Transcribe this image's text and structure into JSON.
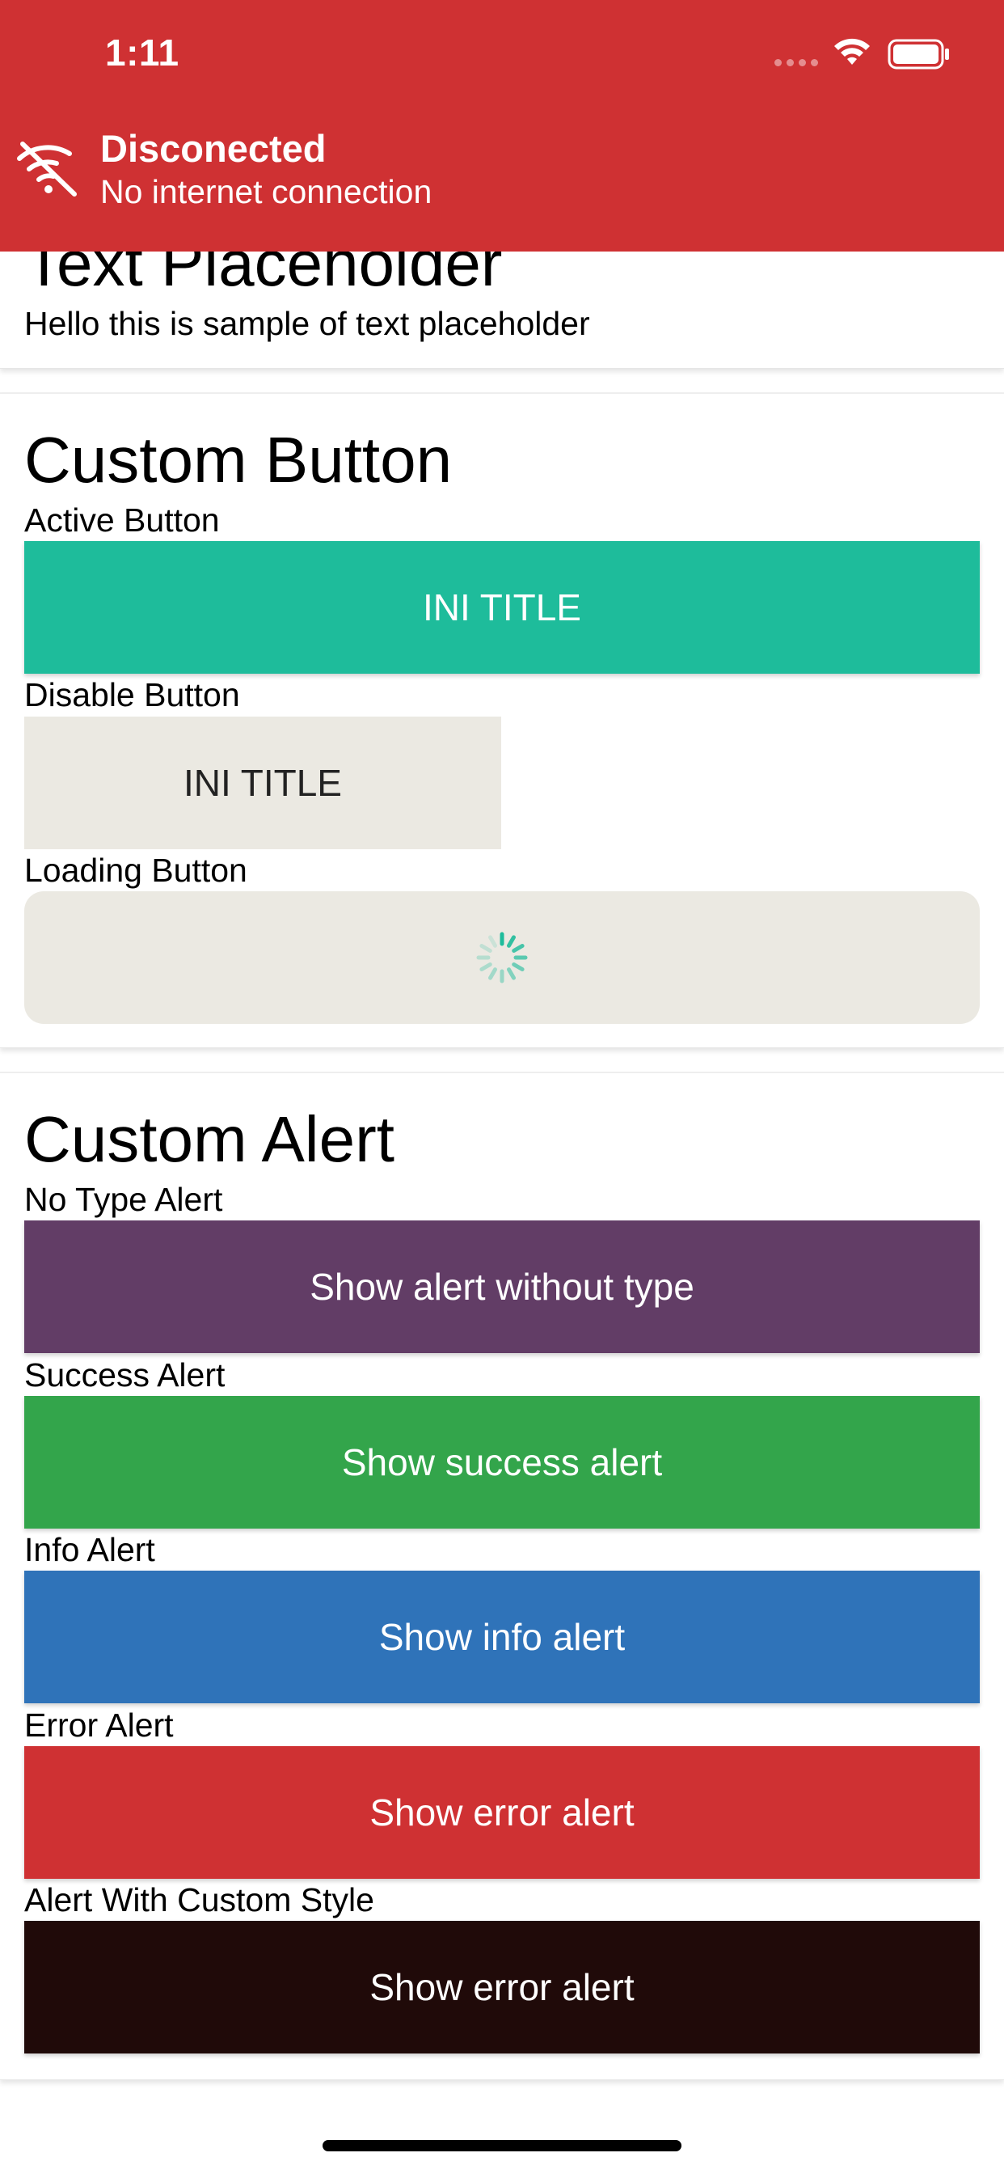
{
  "status_bar": {
    "time": "1:11"
  },
  "offline_banner": {
    "icon": "wifi-off-icon",
    "title": "Disconected",
    "subtitle": "No internet connection",
    "color": "#cf3133"
  },
  "text_placeholder": {
    "title": "Text Placeholder",
    "text": "Hello this is sample of text placeholder"
  },
  "custom_button": {
    "title": "Custom Button",
    "active": {
      "caption": "Active Button",
      "label": "INI TITLE",
      "color": "#1ebc9b"
    },
    "disabled": {
      "caption": "Disable Button",
      "label": "INI TITLE",
      "color": "#ebe9e2"
    },
    "loading": {
      "caption": "Loading Button",
      "color": "#ebe9e2",
      "icon": "loading-spinner-icon"
    }
  },
  "custom_alert": {
    "title": "Custom Alert",
    "items": [
      {
        "caption": "No Type Alert",
        "label": "Show alert without type",
        "color": "#623d66"
      },
      {
        "caption": "Success Alert",
        "label": "Show success alert",
        "color": "#33a54b"
      },
      {
        "caption": "Info Alert",
        "label": "Show info alert",
        "color": "#2f73b9"
      },
      {
        "caption": "Error Alert",
        "label": "Show error alert",
        "color": "#cf3133"
      },
      {
        "caption": "Alert With Custom Style",
        "label": "Show error alert",
        "color": "#200a09"
      }
    ]
  }
}
